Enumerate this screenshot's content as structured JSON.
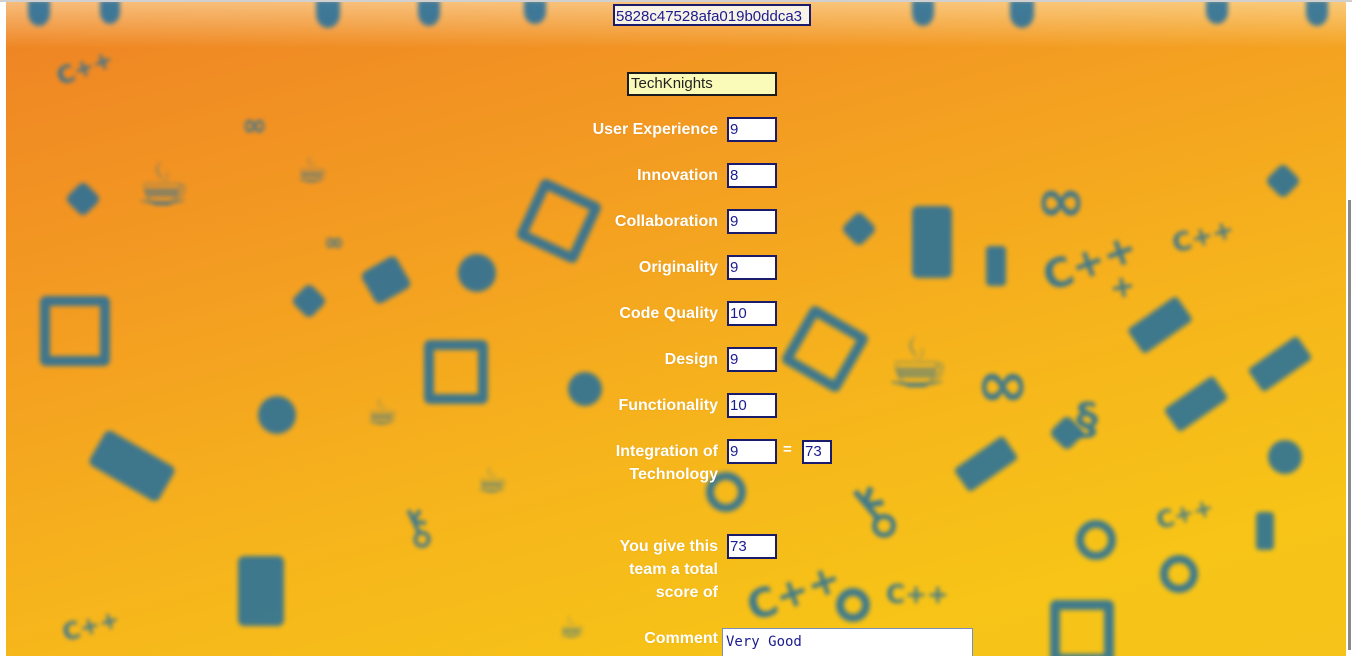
{
  "team_id": "5828c47528afa019b0ddca3",
  "team_name": "TechKnights",
  "criteria": [
    {
      "label": "User Experience",
      "value": "9"
    },
    {
      "label": "Innovation",
      "value": "8"
    },
    {
      "label": "Collaboration",
      "value": "9"
    },
    {
      "label": "Originality",
      "value": "9"
    },
    {
      "label": "Code Quality",
      "value": "10"
    },
    {
      "label": "Design",
      "value": "9"
    },
    {
      "label": "Functionality",
      "value": "10"
    },
    {
      "label": "Integration of Technology",
      "value": "9"
    }
  ],
  "equals_sign": "=",
  "computed_sum": "73",
  "total": {
    "label": "You give this team a total score of",
    "value": "73"
  },
  "comment": {
    "label": "Comment",
    "value": "Very Good"
  },
  "colors": {
    "background_top": "#ee8224",
    "background_bottom": "#f7c417",
    "pattern": "#1f6ea0",
    "field_border": "#1b1b6b",
    "field_text": "#1b1b8f",
    "team_field_bg": "#fbfbb9"
  }
}
